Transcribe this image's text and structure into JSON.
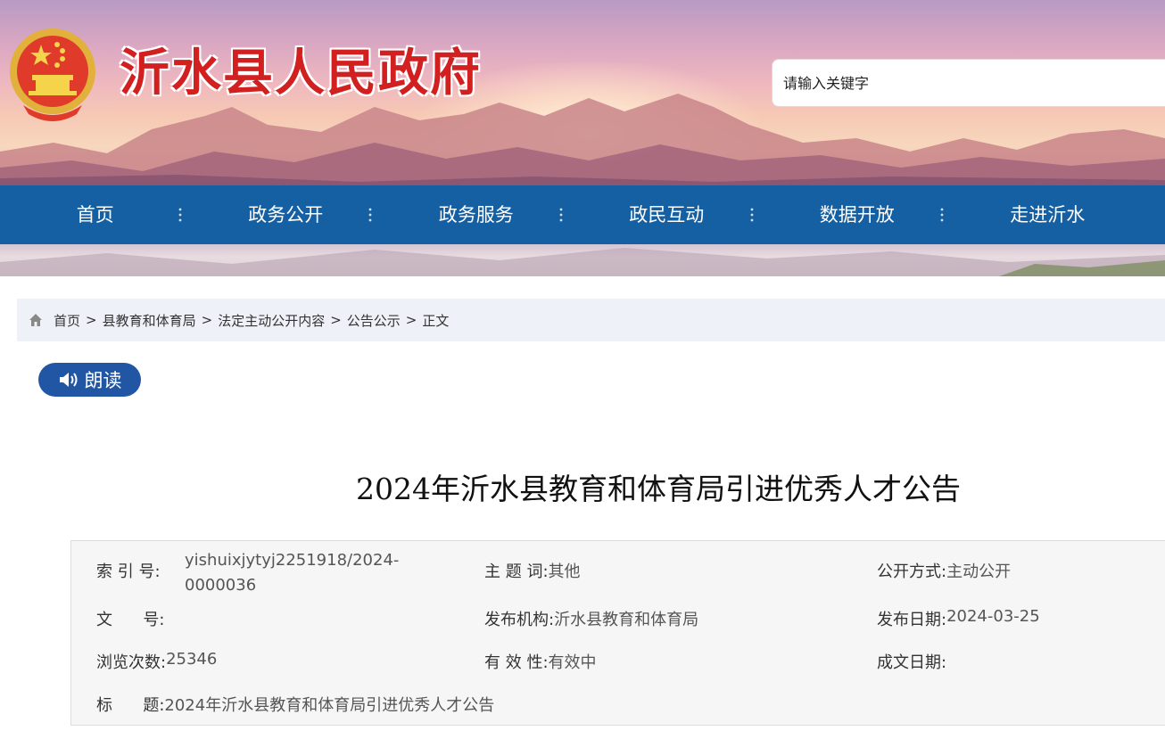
{
  "header": {
    "site_title": "沂水县人民政府",
    "search_placeholder": "请输入关键字"
  },
  "nav": {
    "items": [
      "首页",
      "政务公开",
      "政务服务",
      "政民互动",
      "数据开放",
      "走进沂水"
    ],
    "color": "#155fa3"
  },
  "breadcrumb": {
    "items": [
      "首页",
      "县教育和体育局",
      "法定主动公开内容",
      "公告公示",
      "正文"
    ],
    "separator": ">"
  },
  "read_button": {
    "label": "朗读",
    "color": "#2156a4"
  },
  "article": {
    "title": "2024年沂水县教育和体育局引进优秀人才公告"
  },
  "meta": {
    "index_no": {
      "label": "索 引 号:",
      "value_line1": "yishuixjytyj2251918/2024-",
      "value_line2": "0000036"
    },
    "subject": {
      "label": "主 题 词:",
      "value": "其他"
    },
    "disclosure": {
      "label": "公开方式:",
      "value": "主动公开"
    },
    "doc_no": {
      "label": "文      号:",
      "value": ""
    },
    "publisher": {
      "label": "发布机构:",
      "value": "沂水县教育和体育局"
    },
    "publish_date": {
      "label": "发布日期:",
      "value": "2024-03-25"
    },
    "views": {
      "label": "浏览次数:",
      "value": "25346"
    },
    "validity": {
      "label": "有 效 性:",
      "value": "有效中"
    },
    "written_date": {
      "label": "成文日期:",
      "value": ""
    },
    "title": {
      "label": "标      题:",
      "value": "2024年沂水县教育和体育局引进优秀人才公告"
    }
  }
}
